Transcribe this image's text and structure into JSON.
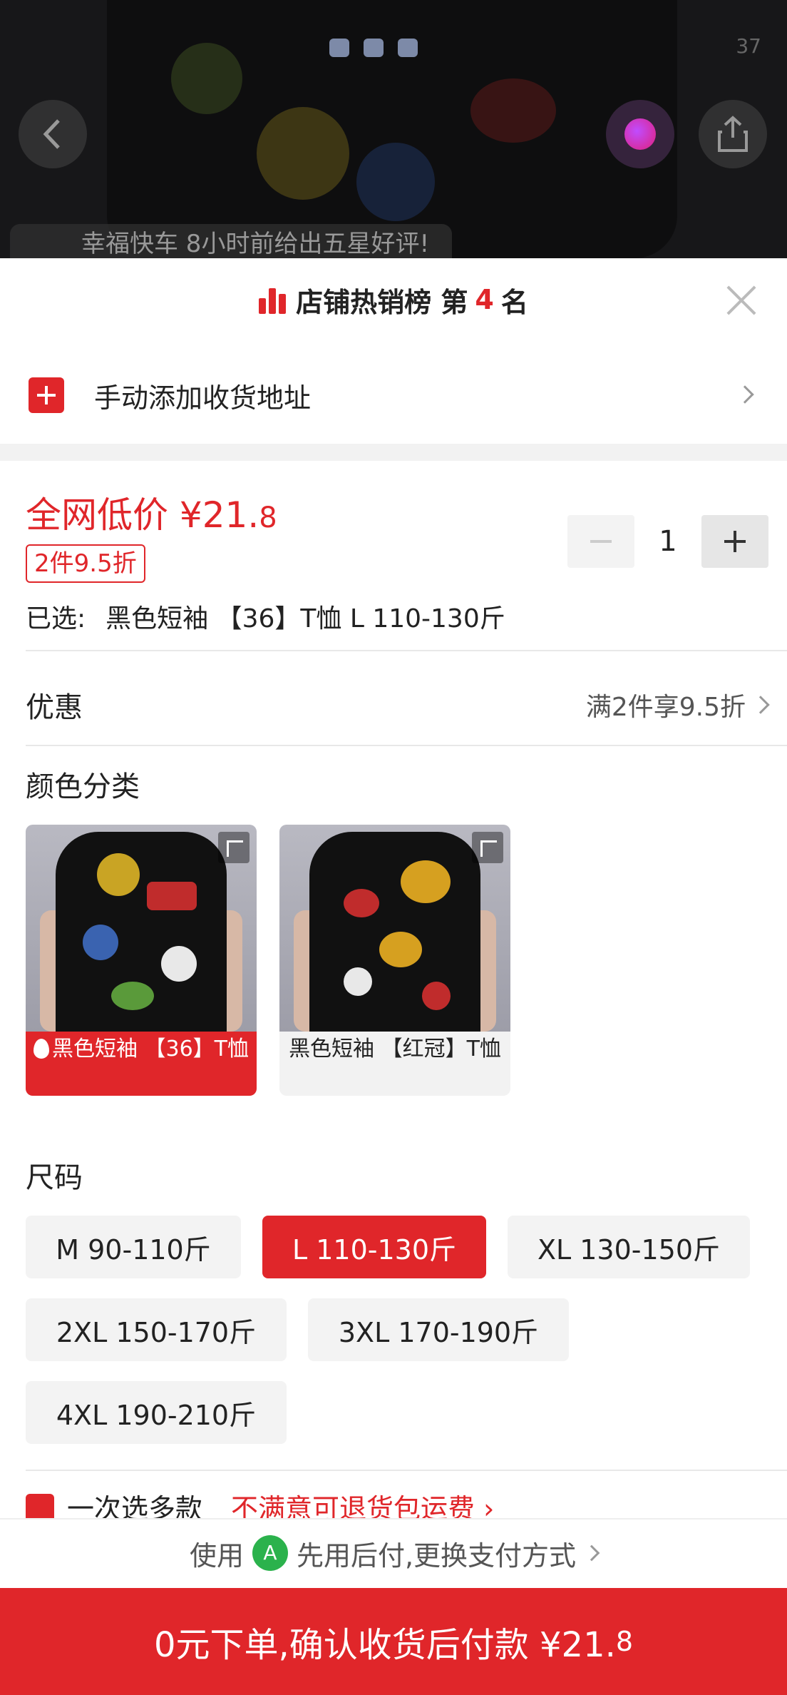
{
  "header": {
    "ticker_text": "幸福快车 8小时前给出五星好评!",
    "status_right": "37"
  },
  "rank": {
    "prefix": "店铺热销榜 第",
    "number": "4",
    "suffix": "名"
  },
  "address": {
    "label": "手动添加收货地址"
  },
  "price": {
    "label": "全网低价 ¥21.",
    "decimal": "8",
    "discount_tag": "2件9.5折"
  },
  "quantity": {
    "value": "1"
  },
  "selected": {
    "label": "已选:",
    "value": "黑色短袖 【36】T恤 L 110-130斤"
  },
  "promo": {
    "label": "优惠",
    "value": "满2件享9.5折"
  },
  "color_section": {
    "title": "颜色分类",
    "options": [
      {
        "label": "黑色短袖 【36】T恤",
        "selected": true
      },
      {
        "label": "黑色短袖 【红冠】T恤",
        "selected": false
      }
    ]
  },
  "size_section": {
    "title": "尺码",
    "options": [
      {
        "label": "M 90-110斤",
        "selected": false
      },
      {
        "label": "L 110-130斤",
        "selected": true
      },
      {
        "label": "XL 130-150斤",
        "selected": false
      },
      {
        "label": "2XL 150-170斤",
        "selected": false
      },
      {
        "label": "3XL 170-190斤",
        "selected": false
      },
      {
        "label": "4XL 190-210斤",
        "selected": false
      }
    ]
  },
  "extra": {
    "left": "一次选多款",
    "right": "不满意可退货包运费 ›"
  },
  "payment": {
    "prefix": "使用",
    "badge": "A",
    "text": "先用后付,更换支付方式"
  },
  "cta": {
    "label": "0元下单,确认收货后付款 ¥21.",
    "decimal": "8"
  },
  "colors": {
    "accent": "#e0262a",
    "pay_badge": "#2bb24c"
  }
}
